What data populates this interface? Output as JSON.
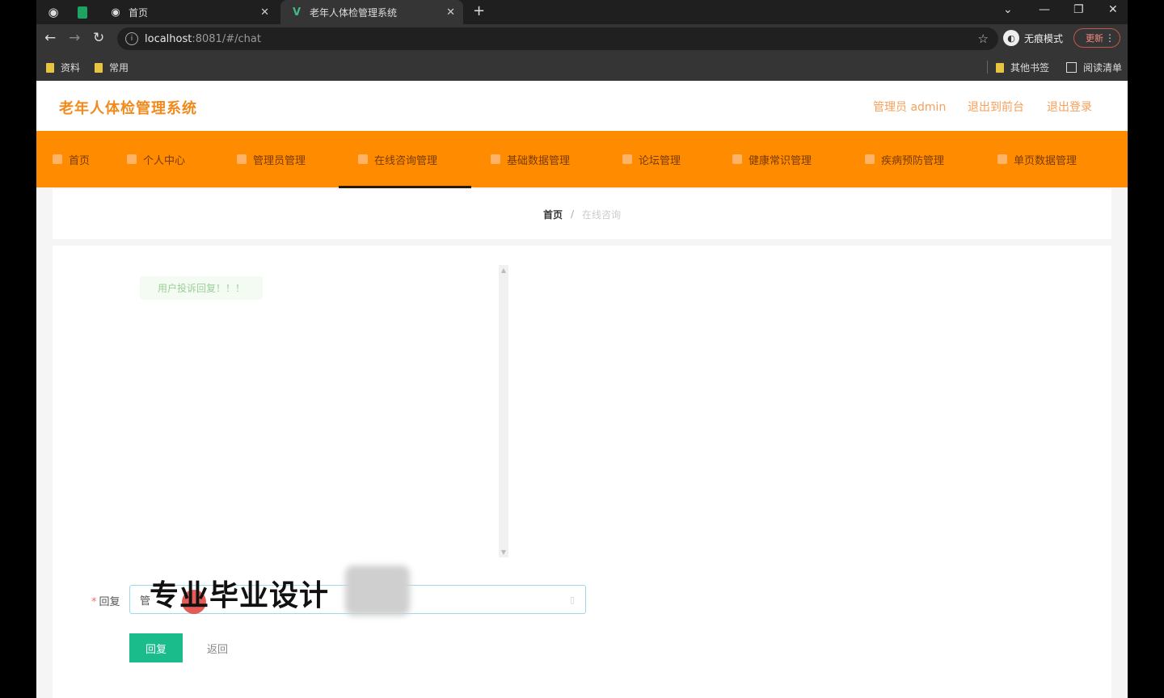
{
  "browser": {
    "tabs": [
      {
        "title": "首页"
      },
      {
        "title": "老年人体检管理系统"
      }
    ],
    "address": {
      "host": "localhost",
      "path": ":8081/#/chat"
    },
    "incognito_label": "无痕模式",
    "update_label": "更新",
    "bookmarks": {
      "left": [
        "资料",
        "常用"
      ],
      "other": "其他书签",
      "reading_list": "阅读清单"
    }
  },
  "header": {
    "brand": "老年人体检管理系统",
    "admin": "管理员 admin",
    "exit_backend": "退出到前台",
    "logout": "退出登录"
  },
  "nav": {
    "items": [
      "首页",
      "个人中心",
      "管理员管理",
      "在线咨询管理",
      "基础数据管理",
      "论坛管理",
      "健康常识管理",
      "疾病预防管理",
      "单页数据管理"
    ]
  },
  "breadcrumb": {
    "home": "首页",
    "sep": "/",
    "current": "在线咨询"
  },
  "chat": {
    "messages": [
      "用户投诉回复！！！"
    ]
  },
  "form": {
    "reply_label": "回复",
    "reply_value": "管",
    "submit": "回复",
    "back": "返回"
  },
  "overlay": {
    "watermark": "专业毕业设计"
  }
}
